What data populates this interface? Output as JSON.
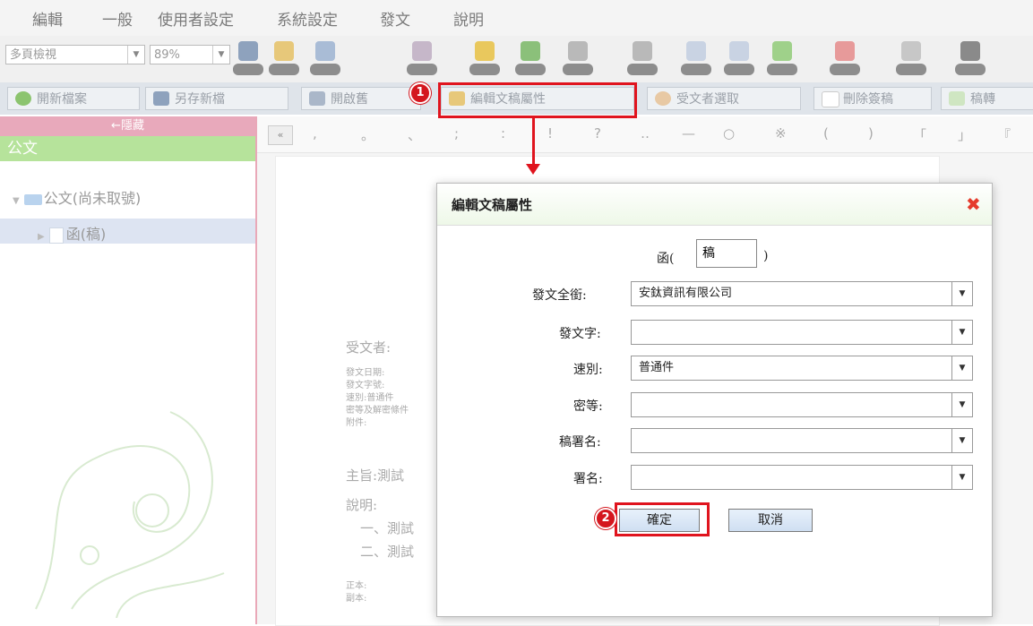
{
  "menu": [
    "編輯",
    "一般",
    "使用者設定",
    "系統設定",
    "發文",
    "說明"
  ],
  "toolbar": {
    "view_mode": "多頁檢視",
    "zoom": "89%"
  },
  "actions": [
    "開新檔案",
    "另存新檔",
    "開啟舊",
    "編輯文稿屬性",
    "受文者選取",
    "刪除簽稿",
    "稿轉"
  ],
  "sidebar": {
    "hide_label": "←隱藏",
    "section": "公文",
    "tree_root": "公文(尚未取號)",
    "tree_child": "函(稿)"
  },
  "symbols": [
    ",",
    "。",
    "、",
    ";",
    ":",
    "!",
    "?",
    "‥",
    "—",
    "○",
    "※",
    "(",
    ")",
    "「",
    "」",
    "『"
  ],
  "paper": {
    "receiver": "受文者:",
    "meta": [
      "發文日期:",
      "發文字號:",
      "速別:普通件",
      "密等及解密條件",
      "附件:"
    ],
    "subject": "主旨:測試",
    "desc": "說明:",
    "items": [
      "一、測試",
      "二、測試"
    ],
    "copies": [
      "正本:",
      "副本:"
    ]
  },
  "dialog": {
    "title": "編輯文稿屬性",
    "doc_prefix": "函(",
    "doc_type": "稿",
    "doc_suffix": ")",
    "fields": [
      {
        "label": "發文全銜:",
        "value": "安鈦資訊有限公司"
      },
      {
        "label": "發文字:",
        "value": ""
      },
      {
        "label": "速別:",
        "value": "普通件"
      },
      {
        "label": "密等:",
        "value": ""
      },
      {
        "label": "稿署名:",
        "value": ""
      },
      {
        "label": "署名:",
        "value": ""
      }
    ],
    "ok": "確定",
    "cancel": "取消"
  },
  "annotations": {
    "step1": "1",
    "step2": "2",
    "accent": "#e0141e"
  }
}
